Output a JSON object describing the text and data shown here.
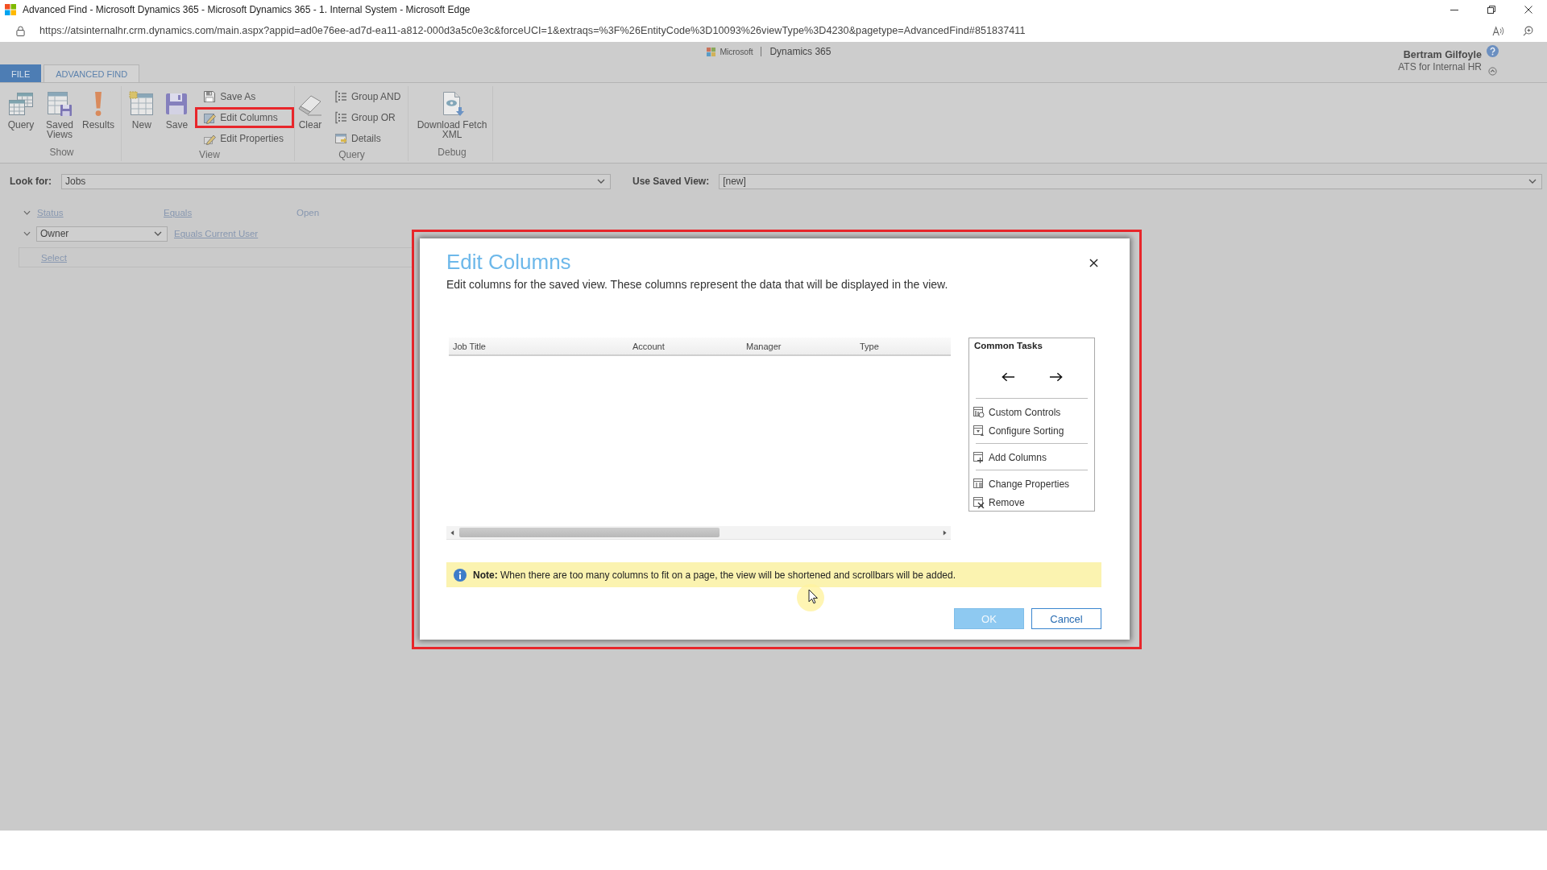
{
  "window": {
    "title": "Advanced Find - Microsoft Dynamics 365 - Microsoft Dynamics 365 - 1. Internal System - Microsoft Edge"
  },
  "address_bar": {
    "url": "https://atsinternalhr.crm.dynamics.com/main.aspx?appid=ad0e76ee-ad7d-ea11-a812-000d3a5c0e3c&forceUCI=1&extraqs=%3F%26EntityCode%3D10093%26viewType%3D4230&pagetype=AdvancedFind#851837411"
  },
  "header": {
    "brand": "Microsoft",
    "product": "Dynamics 365",
    "user_name": "Bertram Gilfoyle",
    "user_org": "ATS for Internal HR"
  },
  "tabs": [
    {
      "label": "FILE",
      "kind": "file",
      "selected": false
    },
    {
      "label": "ADVANCED FIND",
      "kind": "ribbon",
      "selected": true
    }
  ],
  "ribbon": {
    "groups": [
      {
        "label": "Show",
        "buttons": [
          {
            "kind": "large",
            "label": "Query",
            "highlighted": false
          },
          {
            "kind": "large",
            "label": "Saved Views",
            "highlighted": false
          },
          {
            "kind": "large",
            "label": "Results",
            "highlighted": false
          }
        ]
      },
      {
        "label": "View",
        "buttons": [
          {
            "kind": "large",
            "label": "New",
            "highlighted": false
          },
          {
            "kind": "large",
            "label": "Save",
            "highlighted": false
          },
          {
            "kind": "small",
            "label": "Save As",
            "highlighted": false
          },
          {
            "kind": "small",
            "label": "Edit Columns",
            "highlighted": true
          },
          {
            "kind": "small",
            "label": "Edit Properties",
            "highlighted": false
          }
        ]
      },
      {
        "label": "Query",
        "buttons": [
          {
            "kind": "large",
            "label": "Clear",
            "highlighted": false
          },
          {
            "kind": "small",
            "label": "Group AND",
            "highlighted": false
          },
          {
            "kind": "small",
            "label": "Group OR",
            "highlighted": false
          },
          {
            "kind": "small",
            "label": "Details",
            "highlighted": false
          }
        ]
      },
      {
        "label": "Debug",
        "buttons": [
          {
            "kind": "large",
            "label": "Download Fetch XML",
            "highlighted": false
          }
        ]
      }
    ]
  },
  "look_for": {
    "label": "Look for:",
    "value": "Jobs"
  },
  "saved_view": {
    "label": "Use Saved View:",
    "value": "[new]"
  },
  "filters": [
    {
      "kind": "condition",
      "field": "Status",
      "operator": "Equals",
      "value": "Open"
    },
    {
      "kind": "field-select",
      "field": "Owner",
      "operator": "Equals Current User"
    },
    {
      "kind": "add",
      "label": "Select"
    }
  ],
  "dialog": {
    "highlighted": true,
    "title": "Edit Columns",
    "description": "Edit columns for the saved view. These columns represent the data that will be displayed in the view.",
    "columns": [
      "Job Title",
      "Account",
      "Manager",
      "Type"
    ],
    "common_tasks": {
      "title": "Common Tasks",
      "sections": [
        [
          "Custom Controls",
          "Configure Sorting"
        ],
        [
          "Add Columns"
        ],
        [
          "Change Properties",
          "Remove"
        ]
      ]
    },
    "note": "**Note:** When there are too many columns to fit on a page, the view will be shortened and scrollbars will be added.",
    "buttons": [
      {
        "label": "OK",
        "kind": "primary",
        "disabled": true
      },
      {
        "label": "Cancel",
        "kind": "secondary",
        "disabled": false
      }
    ]
  }
}
